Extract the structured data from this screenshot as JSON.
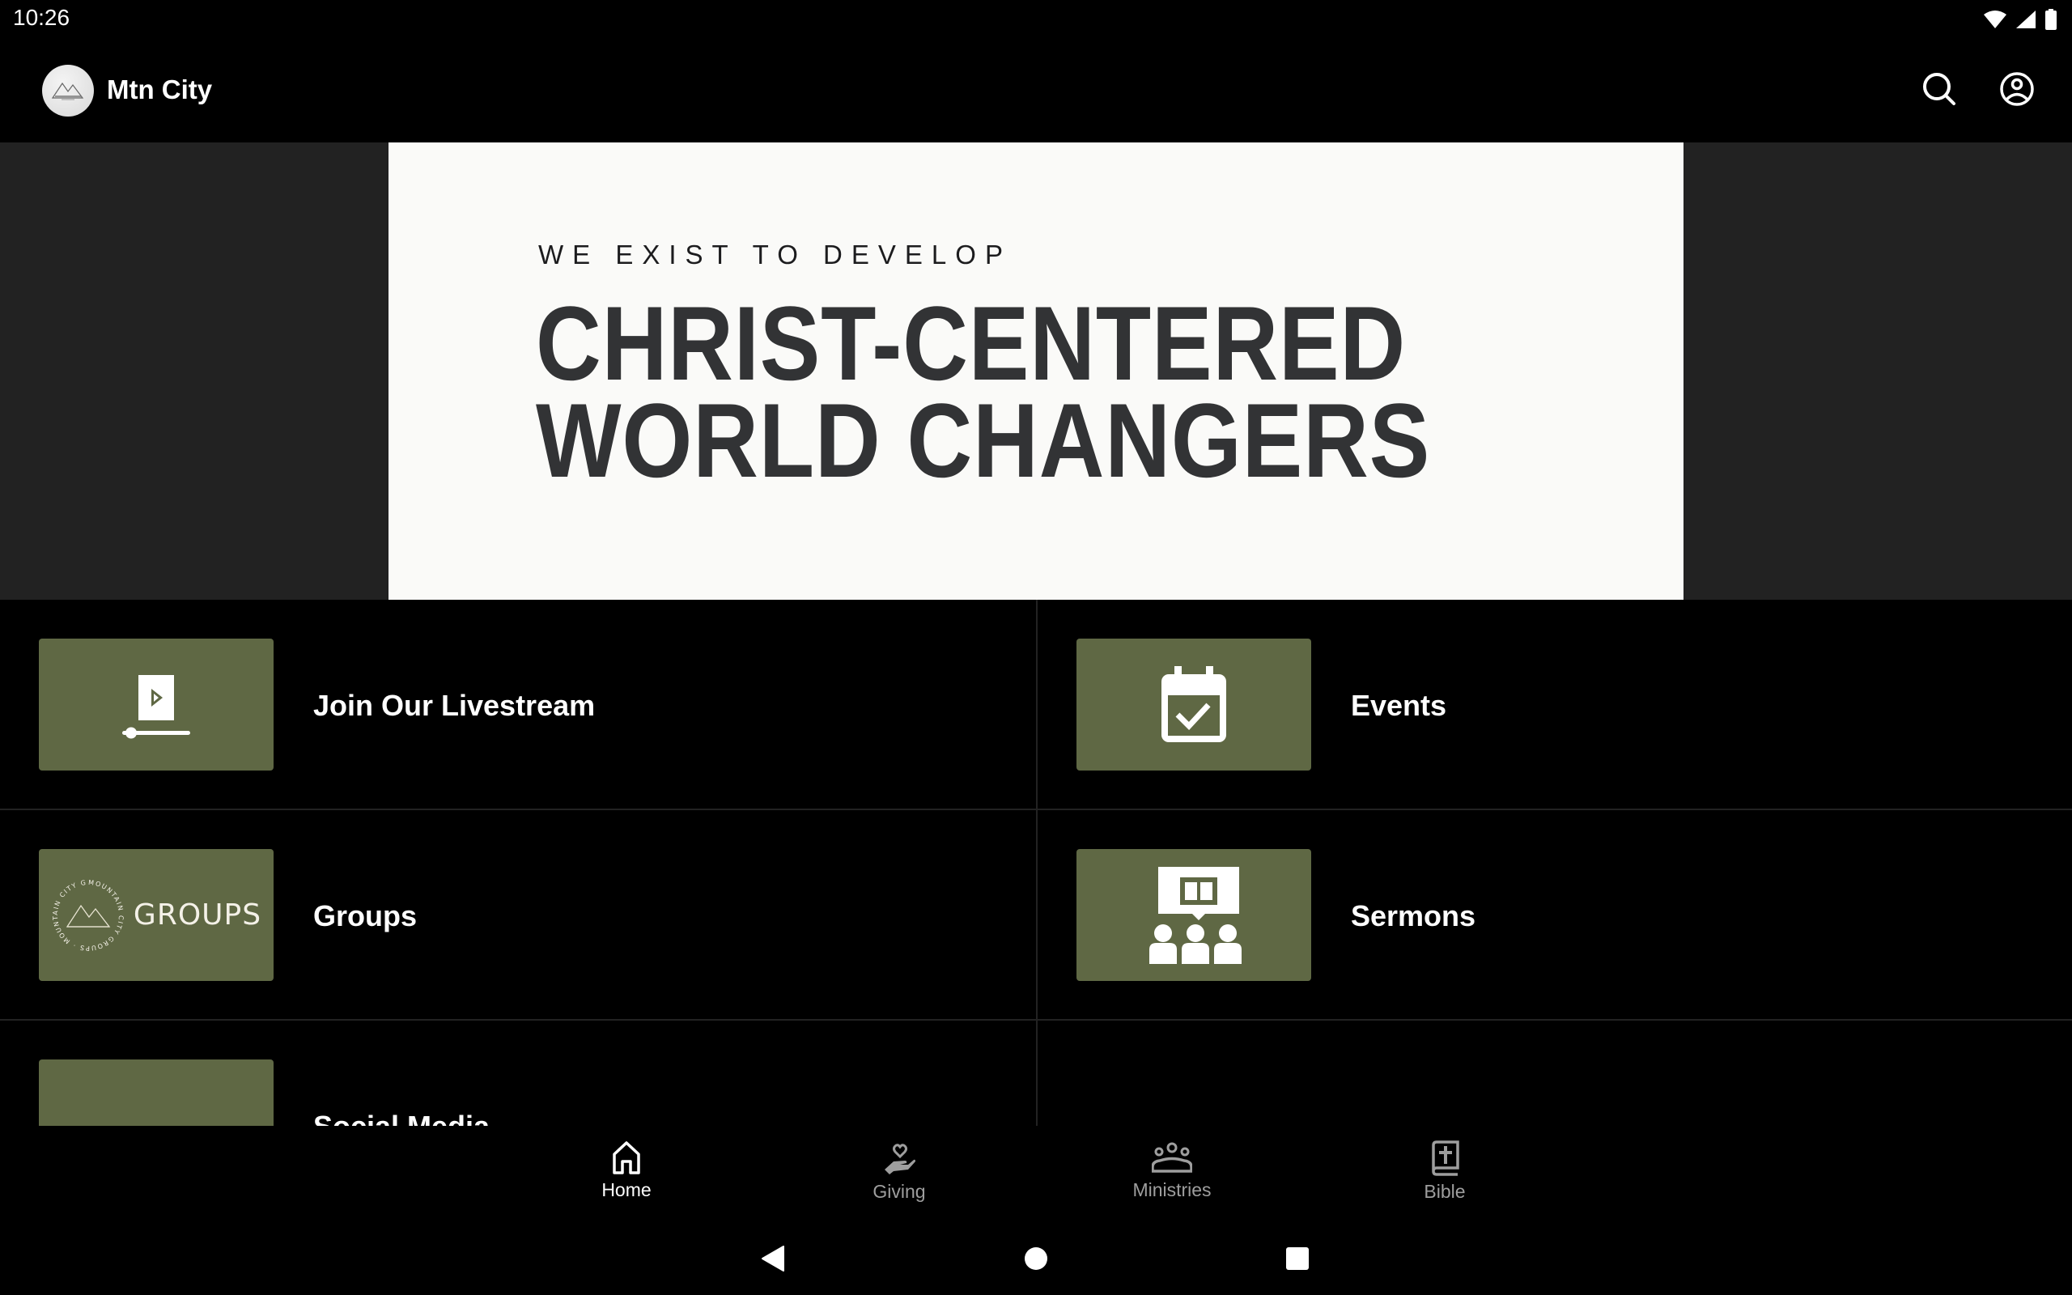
{
  "status_bar": {
    "time": "10:26",
    "icons": [
      "wifi-icon",
      "signal-icon",
      "battery-icon"
    ]
  },
  "app_bar": {
    "title": "Mtn City",
    "logo": "mountain-city-logo",
    "actions": [
      {
        "name": "search",
        "icon": "search-icon"
      },
      {
        "name": "profile",
        "icon": "account-circle-icon"
      }
    ]
  },
  "banner": {
    "kicker": "WE EXIST TO DEVELOP",
    "headline_line1": "CHRIST-CENTERED",
    "headline_line2": "WORLD CHANGERS"
  },
  "tiles": [
    {
      "label": "Join Our Livestream",
      "icon": "livestream-play-icon"
    },
    {
      "label": "Events",
      "icon": "calendar-check-icon"
    },
    {
      "label": "Groups",
      "icon": "groups-logo",
      "thumb_text": "GROUPS",
      "badge_text": "MOUNTAIN CITY GROUPS"
    },
    {
      "label": "Sermons",
      "icon": "sermon-audience-icon"
    },
    {
      "label": "Social Media",
      "icon": "social-media-icons"
    }
  ],
  "bottom_nav": {
    "items": [
      {
        "label": "Home",
        "icon": "home-icon",
        "active": true
      },
      {
        "label": "Giving",
        "icon": "giving-hand-heart-icon",
        "active": false
      },
      {
        "label": "Ministries",
        "icon": "groups-people-icon",
        "active": false
      },
      {
        "label": "Bible",
        "icon": "bible-icon",
        "active": false
      }
    ]
  },
  "system_nav": {
    "buttons": [
      "back",
      "home",
      "recents"
    ]
  },
  "colors": {
    "background": "#000000",
    "banner_side": "#222222",
    "banner_card": "#FAFAF8",
    "headline": "#323335",
    "tile_accent": "#5F6844",
    "nav_active": "#FFFFFF",
    "nav_inactive": "#9E9E9E"
  }
}
